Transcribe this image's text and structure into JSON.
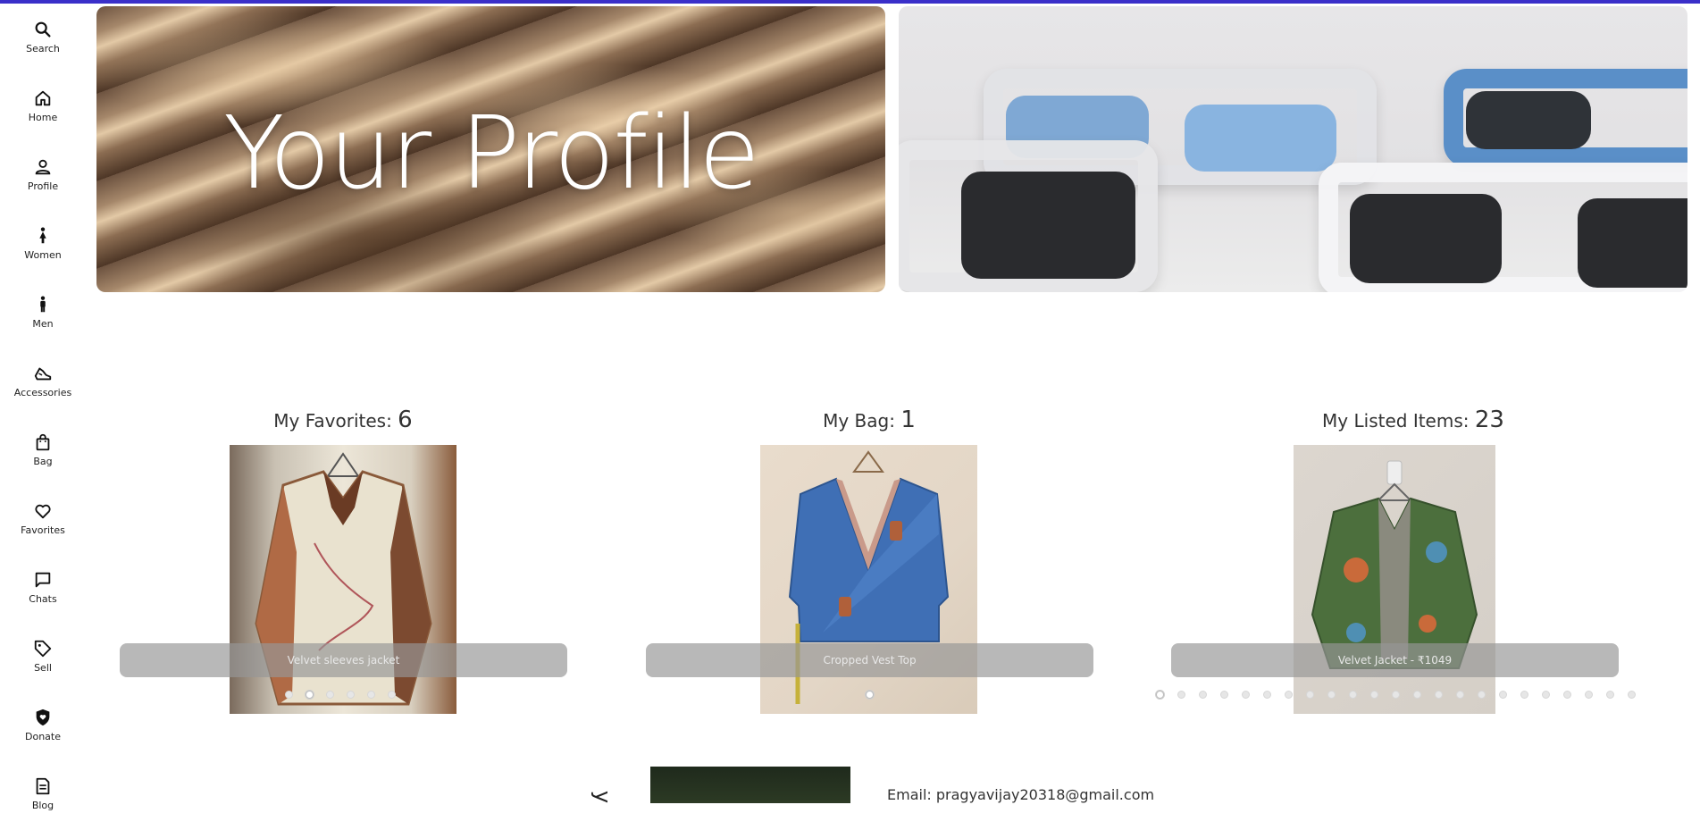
{
  "sidebar": {
    "items": [
      {
        "label": "Search",
        "icon": "search-icon"
      },
      {
        "label": "Home",
        "icon": "home-icon"
      },
      {
        "label": "Profile",
        "icon": "user-icon"
      },
      {
        "label": "Women",
        "icon": "woman-icon"
      },
      {
        "label": "Men",
        "icon": "man-icon"
      },
      {
        "label": "Accessories",
        "icon": "shoe-icon"
      },
      {
        "label": "Bag",
        "icon": "bag-icon"
      },
      {
        "label": "Favorites",
        "icon": "heart-icon"
      },
      {
        "label": "Chats",
        "icon": "chat-icon"
      },
      {
        "label": "Sell",
        "icon": "tag-icon"
      },
      {
        "label": "Donate",
        "icon": "shield-icon"
      },
      {
        "label": "Blog",
        "icon": "document-icon"
      }
    ]
  },
  "banner": {
    "title": "Your Profile"
  },
  "stats": {
    "favorites": {
      "label": "My Favorites: ",
      "count": "6",
      "caption": "Velvet sleeves jacket",
      "dots": 6,
      "active_dot": 2
    },
    "bag": {
      "label": "My Bag: ",
      "count": "1",
      "caption": "Cropped Vest Top",
      "dots": 1,
      "active_dot": 1
    },
    "listed": {
      "label": "My Listed Items: ",
      "count": "23",
      "caption": "Velvet Jacket - ₹1049",
      "dots": 23,
      "active_dot": 1
    }
  },
  "footer": {
    "email": "Email: pragyavijay20318@gmail.com",
    "side_glyph": "y"
  },
  "colors": {
    "accent_bar": "#3a2fc9",
    "caption_bg": "#969696"
  }
}
